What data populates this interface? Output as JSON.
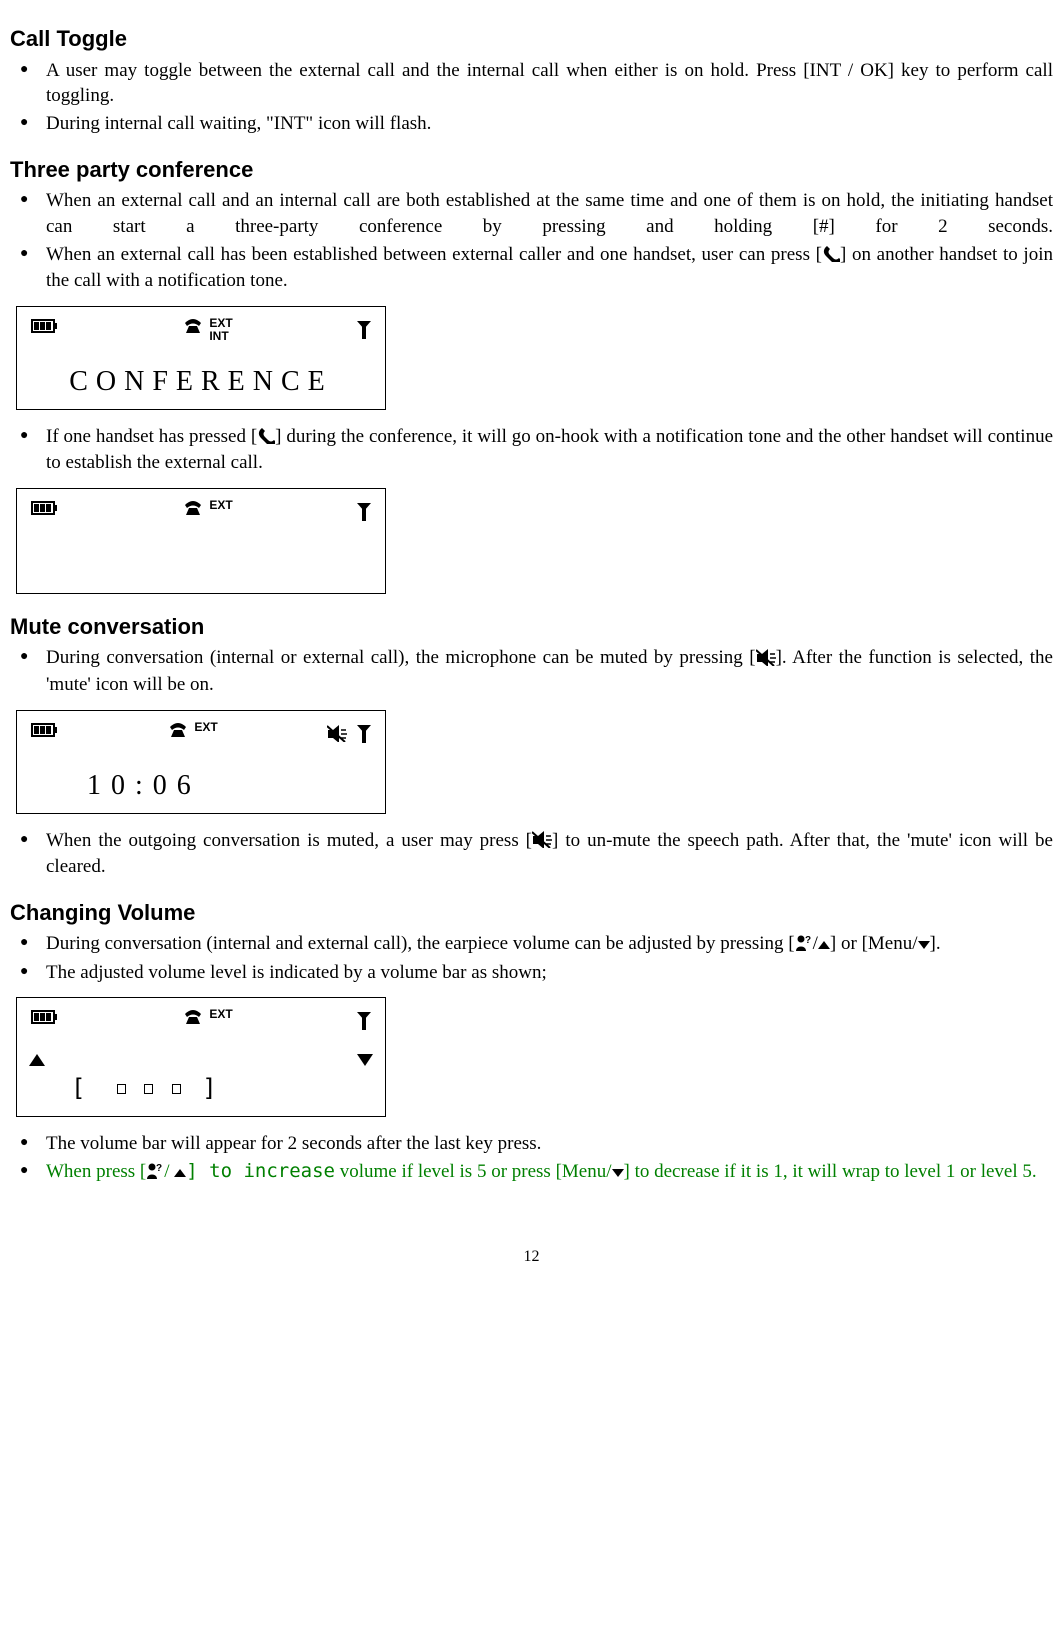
{
  "page_number": "12",
  "sections": {
    "call_toggle": {
      "heading": "Call Toggle",
      "b1": "A user may toggle between the external call and the internal call when either is on hold. Press [INT / OK] key to perform call toggling.",
      "b2": "During internal call waiting, \"INT\" icon will flash."
    },
    "three_party": {
      "heading": "Three party conference",
      "b1": "When an external call and an internal call are both established at the same time and one of them is on hold, the initiating handset can start a three-party conference by pressing and holding [#] for 2 seconds.",
      "b2_a": "When an external call has been established between external caller and one handset, user can press [",
      "b2_b": "] on another handset to join the call with a notification tone.",
      "b3_a": "If one handset has pressed [",
      "b3_b": "] during the conference, it will go on-hook with a notification tone and the other handset will continue to establish the external call."
    },
    "mute": {
      "heading": "Mute conversation",
      "b1_a": "During conversation (internal or external call), the microphone can be muted by pressing [",
      "b1_b": "]. After the function is selected, the 'mute' icon will be on.",
      "b2_a": "When the outgoing conversation is muted, a user may press [",
      "b2_b": "] to un-mute the speech path. After that, the 'mute' icon will be cleared."
    },
    "volume": {
      "heading": "Changing Volume",
      "b1_a": "During conversation (internal and external call), the earpiece volume can be adjusted by pressing [",
      "b1_b": "/",
      "b1_c": "] or [Menu/",
      "b1_d": "].",
      "b2": "The adjusted volume level is indicated by a volume bar as shown;",
      "b3": "The volume bar will appear for 2 seconds after the last key press.",
      "b4_a": "When press [",
      "b4_b": "/ ",
      "b4_c": "] to increase",
      "b4_d": " volume if level is 5 or press [Menu/",
      "b4_e": "] to decrease if it is 1, it will wrap to level 1 or level 5."
    }
  },
  "lcd": {
    "conference": {
      "ext": "EXT",
      "int": "INT",
      "text": "CONFERENCE"
    },
    "ext_only": {
      "ext": "EXT"
    },
    "mute": {
      "ext": "EXT",
      "time": "10:06"
    },
    "volume": {
      "ext": "EXT",
      "bar_open": "[",
      "bar_close": "]"
    }
  }
}
